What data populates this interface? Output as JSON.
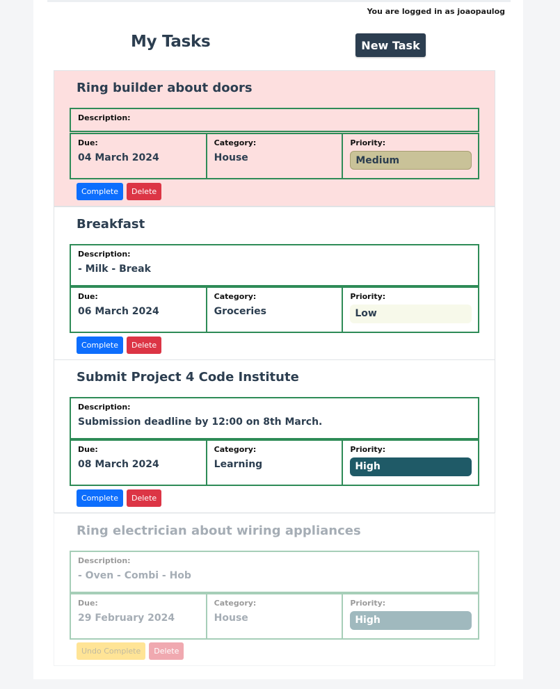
{
  "header": {
    "login_text": "You are logged in as joaopaulog",
    "title": "My Tasks",
    "new_task_label": "New Task"
  },
  "labels": {
    "description": "Description:",
    "due": "Due:",
    "category": "Category:",
    "priority": "Priority:",
    "complete": "Complete",
    "undo_complete": "Undo Complete",
    "delete": "Delete"
  },
  "tasks": [
    {
      "title": "Ring builder about doors",
      "description": "",
      "due": "04 March 2024",
      "category": "House",
      "priority": "Medium",
      "status": "overdue"
    },
    {
      "title": "Breakfast",
      "description": "- Milk - Break",
      "due": "06 March 2024",
      "category": "Groceries",
      "priority": "Low",
      "status": "open"
    },
    {
      "title": "Submit Project 4 Code Institute",
      "description": "Submission deadline by 12:00 on 8th March.",
      "due": "08 March 2024",
      "category": "Learning",
      "priority": "High",
      "status": "open"
    },
    {
      "title": "Ring electrician about wiring appliances",
      "description": "- Oven - Combi - Hob",
      "due": "29 February 2024",
      "category": "House",
      "priority": "High",
      "status": "completed"
    }
  ],
  "colors": {
    "primary": "#2c3e50",
    "overdue_bg": "#fddfdf",
    "border_green": "#2e8b57",
    "complete_btn": "#0d6efd",
    "delete_btn": "#dc3545",
    "undo_btn": "#ffc107",
    "priority_medium": "#c9c298",
    "priority_low": "#f7f9ea",
    "priority_high": "#1f5a67"
  }
}
